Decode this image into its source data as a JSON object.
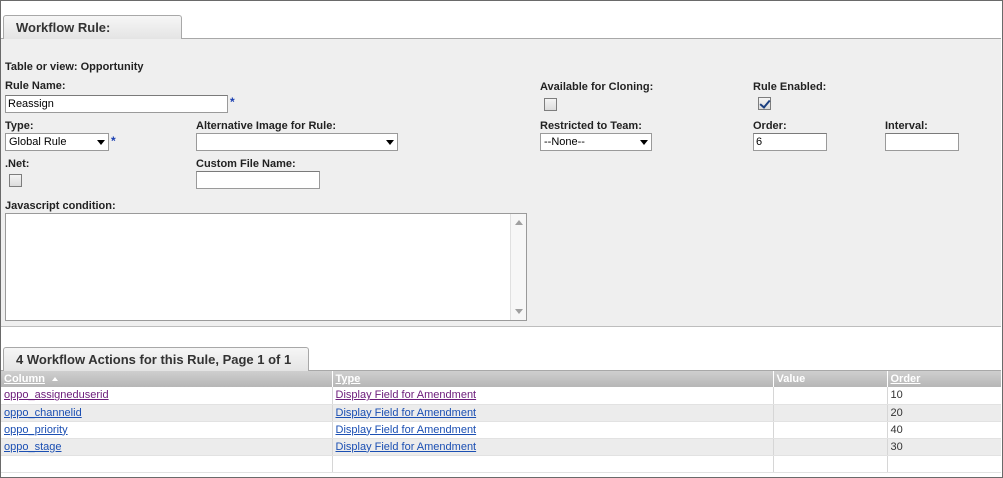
{
  "header": {
    "tab_title": "Workflow Rule: Reassign"
  },
  "form": {
    "table_or_view": "Table or view: Opportunity",
    "rule_name": {
      "label": "Rule Name:",
      "value": "Reassign",
      "required": "*"
    },
    "available_for_cloning": {
      "label": "Available for Cloning:",
      "checked": false
    },
    "rule_enabled": {
      "label": "Rule Enabled:",
      "checked": true
    },
    "type": {
      "label": "Type:",
      "value": "Global Rule",
      "required": "*"
    },
    "alternative_image": {
      "label": "Alternative Image for Rule:",
      "value": ""
    },
    "restricted_to_team": {
      "label": "Restricted to Team:",
      "value": "--None--"
    },
    "order": {
      "label": "Order:",
      "value": "6"
    },
    "interval": {
      "label": "Interval:",
      "value": ""
    },
    "dotnet": {
      "label": ".Net:",
      "checked": false
    },
    "custom_file_name": {
      "label": "Custom File Name:",
      "value": ""
    },
    "javascript_condition": {
      "label": "Javascript condition:",
      "value": ""
    }
  },
  "actions": {
    "tab_title": "4 Workflow Actions for this Rule, Page 1 of 1",
    "columns": [
      "Column",
      "Type",
      "Value",
      "Order"
    ],
    "rows": [
      {
        "column": "oppo_assigneduserid",
        "type": "Display Field for Amendment",
        "value": "",
        "order": "10"
      },
      {
        "column": "oppo_channelid",
        "type": "Display Field for Amendment",
        "value": "",
        "order": "20"
      },
      {
        "column": "oppo_priority",
        "type": "Display Field for Amendment",
        "value": "",
        "order": "40"
      },
      {
        "column": "oppo_stage",
        "type": "Display Field for Amendment",
        "value": "",
        "order": "30"
      }
    ]
  }
}
